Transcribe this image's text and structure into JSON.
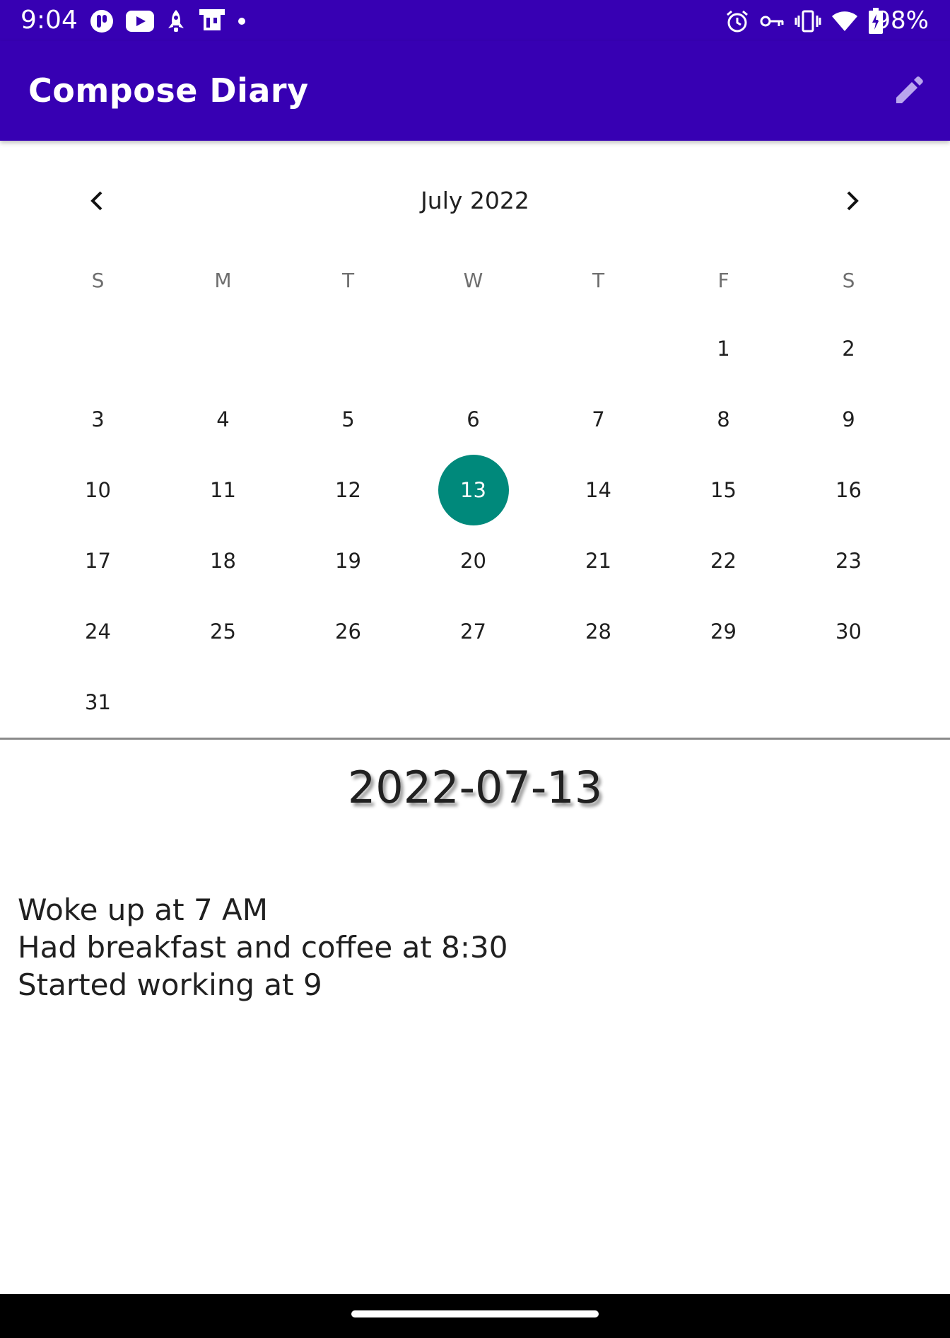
{
  "status_bar": {
    "time": "9:04",
    "battery_percent": "98%",
    "left_icons": [
      "chat-bubble-icon",
      "youtube-icon",
      "rocket-icon",
      "cast-device-icon",
      "dot-icon"
    ],
    "right_icons": [
      "alarm-icon",
      "vpn-key-icon",
      "vibrate-icon",
      "wifi-icon",
      "battery-charging-icon"
    ]
  },
  "app_bar": {
    "title": "Compose Diary",
    "action_icon": "edit-pencil-icon",
    "background_color": "#3700b3"
  },
  "calendar": {
    "month_label": "July 2022",
    "prev_icon": "chevron-left-icon",
    "next_icon": "chevron-right-icon",
    "weekdays": [
      "S",
      "M",
      "T",
      "W",
      "T",
      "F",
      "S"
    ],
    "days": [
      "",
      "",
      "",
      "",
      "",
      "1",
      "2",
      "3",
      "4",
      "5",
      "6",
      "7",
      "8",
      "9",
      "10",
      "11",
      "12",
      "13",
      "14",
      "15",
      "16",
      "17",
      "18",
      "19",
      "20",
      "21",
      "22",
      "23",
      "24",
      "25",
      "26",
      "27",
      "28",
      "29",
      "30",
      "31"
    ],
    "selected_day": "13",
    "selected_color": "#00897b"
  },
  "entry": {
    "date": "2022-07-13",
    "lines": [
      "Woke up at 7 AM",
      "Had breakfast and coffee at 8:30",
      "Started working at 9"
    ]
  }
}
